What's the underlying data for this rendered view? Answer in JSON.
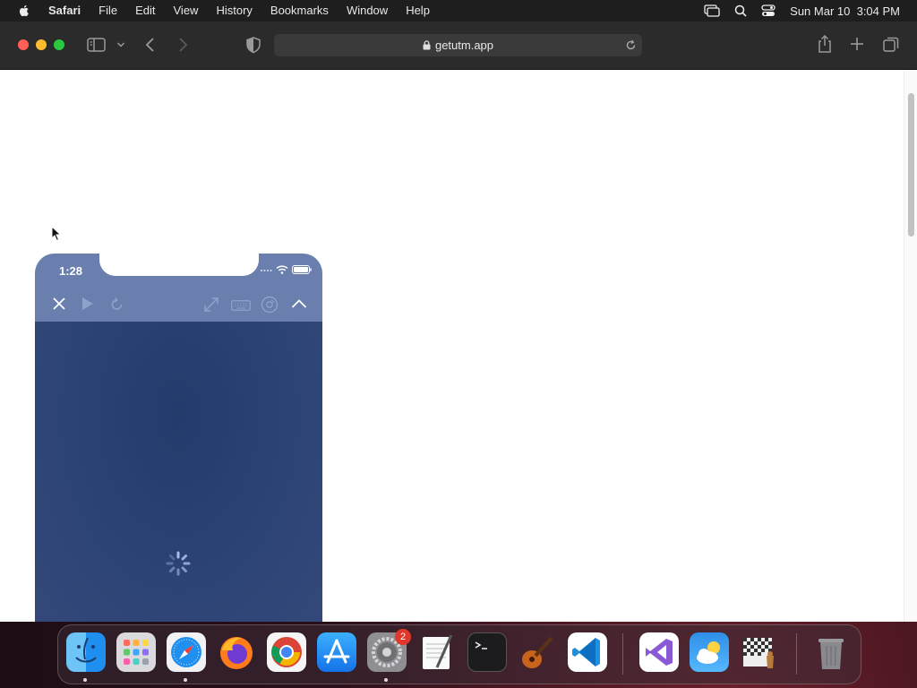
{
  "menubar": {
    "app_name": "Safari",
    "menus": [
      "File",
      "Edit",
      "View",
      "History",
      "Bookmarks",
      "Window",
      "Help"
    ],
    "clock": "Sun Mar 10  3:04 PM"
  },
  "browser": {
    "url": "getutm.app"
  },
  "phone": {
    "time": "1:28"
  },
  "dock": {
    "apps": [
      "Finder",
      "Launchpad",
      "Safari",
      "Firefox",
      "Google Chrome",
      "App Store",
      "System Settings",
      "TextEdit",
      "Terminal",
      "GarageBand",
      "Visual Studio Code",
      "Visual Studio",
      "Weather",
      "Chess",
      "Trash"
    ],
    "settings_badge": "2"
  }
}
